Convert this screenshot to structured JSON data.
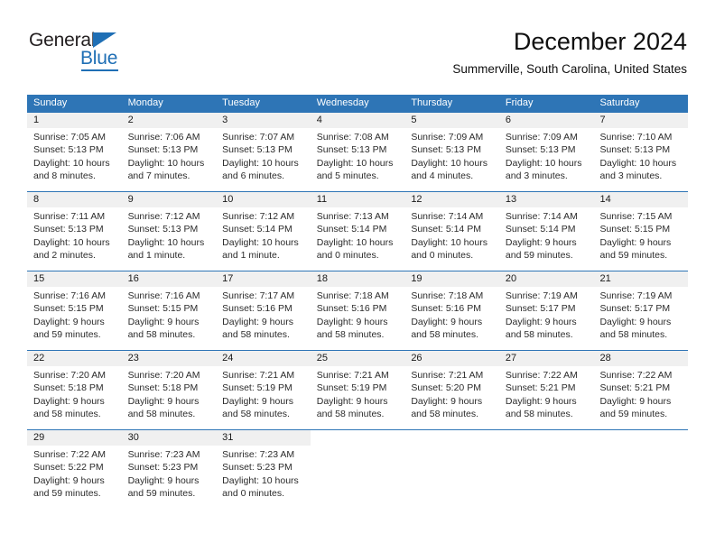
{
  "logo": {
    "top_text": "General",
    "bottom_text": "Blue",
    "accent_color": "#1f6fb5"
  },
  "header": {
    "title": "December 2024",
    "subtitle": "Summerville, South Carolina, United States"
  },
  "theme": {
    "header_blue": "#2e75b6",
    "day_band_gray": "#f0f0f0"
  },
  "weekdays": [
    "Sunday",
    "Monday",
    "Tuesday",
    "Wednesday",
    "Thursday",
    "Friday",
    "Saturday"
  ],
  "weeks": [
    [
      {
        "day": "1",
        "sunrise": "Sunrise: 7:05 AM",
        "sunset": "Sunset: 5:13 PM",
        "daylight_line1": "Daylight: 10 hours",
        "daylight_line2": "and 8 minutes."
      },
      {
        "day": "2",
        "sunrise": "Sunrise: 7:06 AM",
        "sunset": "Sunset: 5:13 PM",
        "daylight_line1": "Daylight: 10 hours",
        "daylight_line2": "and 7 minutes."
      },
      {
        "day": "3",
        "sunrise": "Sunrise: 7:07 AM",
        "sunset": "Sunset: 5:13 PM",
        "daylight_line1": "Daylight: 10 hours",
        "daylight_line2": "and 6 minutes."
      },
      {
        "day": "4",
        "sunrise": "Sunrise: 7:08 AM",
        "sunset": "Sunset: 5:13 PM",
        "daylight_line1": "Daylight: 10 hours",
        "daylight_line2": "and 5 minutes."
      },
      {
        "day": "5",
        "sunrise": "Sunrise: 7:09 AM",
        "sunset": "Sunset: 5:13 PM",
        "daylight_line1": "Daylight: 10 hours",
        "daylight_line2": "and 4 minutes."
      },
      {
        "day": "6",
        "sunrise": "Sunrise: 7:09 AM",
        "sunset": "Sunset: 5:13 PM",
        "daylight_line1": "Daylight: 10 hours",
        "daylight_line2": "and 3 minutes."
      },
      {
        "day": "7",
        "sunrise": "Sunrise: 7:10 AM",
        "sunset": "Sunset: 5:13 PM",
        "daylight_line1": "Daylight: 10 hours",
        "daylight_line2": "and 3 minutes."
      }
    ],
    [
      {
        "day": "8",
        "sunrise": "Sunrise: 7:11 AM",
        "sunset": "Sunset: 5:13 PM",
        "daylight_line1": "Daylight: 10 hours",
        "daylight_line2": "and 2 minutes."
      },
      {
        "day": "9",
        "sunrise": "Sunrise: 7:12 AM",
        "sunset": "Sunset: 5:13 PM",
        "daylight_line1": "Daylight: 10 hours",
        "daylight_line2": "and 1 minute."
      },
      {
        "day": "10",
        "sunrise": "Sunrise: 7:12 AM",
        "sunset": "Sunset: 5:14 PM",
        "daylight_line1": "Daylight: 10 hours",
        "daylight_line2": "and 1 minute."
      },
      {
        "day": "11",
        "sunrise": "Sunrise: 7:13 AM",
        "sunset": "Sunset: 5:14 PM",
        "daylight_line1": "Daylight: 10 hours",
        "daylight_line2": "and 0 minutes."
      },
      {
        "day": "12",
        "sunrise": "Sunrise: 7:14 AM",
        "sunset": "Sunset: 5:14 PM",
        "daylight_line1": "Daylight: 10 hours",
        "daylight_line2": "and 0 minutes."
      },
      {
        "day": "13",
        "sunrise": "Sunrise: 7:14 AM",
        "sunset": "Sunset: 5:14 PM",
        "daylight_line1": "Daylight: 9 hours",
        "daylight_line2": "and 59 minutes."
      },
      {
        "day": "14",
        "sunrise": "Sunrise: 7:15 AM",
        "sunset": "Sunset: 5:15 PM",
        "daylight_line1": "Daylight: 9 hours",
        "daylight_line2": "and 59 minutes."
      }
    ],
    [
      {
        "day": "15",
        "sunrise": "Sunrise: 7:16 AM",
        "sunset": "Sunset: 5:15 PM",
        "daylight_line1": "Daylight: 9 hours",
        "daylight_line2": "and 59 minutes."
      },
      {
        "day": "16",
        "sunrise": "Sunrise: 7:16 AM",
        "sunset": "Sunset: 5:15 PM",
        "daylight_line1": "Daylight: 9 hours",
        "daylight_line2": "and 58 minutes."
      },
      {
        "day": "17",
        "sunrise": "Sunrise: 7:17 AM",
        "sunset": "Sunset: 5:16 PM",
        "daylight_line1": "Daylight: 9 hours",
        "daylight_line2": "and 58 minutes."
      },
      {
        "day": "18",
        "sunrise": "Sunrise: 7:18 AM",
        "sunset": "Sunset: 5:16 PM",
        "daylight_line1": "Daylight: 9 hours",
        "daylight_line2": "and 58 minutes."
      },
      {
        "day": "19",
        "sunrise": "Sunrise: 7:18 AM",
        "sunset": "Sunset: 5:16 PM",
        "daylight_line1": "Daylight: 9 hours",
        "daylight_line2": "and 58 minutes."
      },
      {
        "day": "20",
        "sunrise": "Sunrise: 7:19 AM",
        "sunset": "Sunset: 5:17 PM",
        "daylight_line1": "Daylight: 9 hours",
        "daylight_line2": "and 58 minutes."
      },
      {
        "day": "21",
        "sunrise": "Sunrise: 7:19 AM",
        "sunset": "Sunset: 5:17 PM",
        "daylight_line1": "Daylight: 9 hours",
        "daylight_line2": "and 58 minutes."
      }
    ],
    [
      {
        "day": "22",
        "sunrise": "Sunrise: 7:20 AM",
        "sunset": "Sunset: 5:18 PM",
        "daylight_line1": "Daylight: 9 hours",
        "daylight_line2": "and 58 minutes."
      },
      {
        "day": "23",
        "sunrise": "Sunrise: 7:20 AM",
        "sunset": "Sunset: 5:18 PM",
        "daylight_line1": "Daylight: 9 hours",
        "daylight_line2": "and 58 minutes."
      },
      {
        "day": "24",
        "sunrise": "Sunrise: 7:21 AM",
        "sunset": "Sunset: 5:19 PM",
        "daylight_line1": "Daylight: 9 hours",
        "daylight_line2": "and 58 minutes."
      },
      {
        "day": "25",
        "sunrise": "Sunrise: 7:21 AM",
        "sunset": "Sunset: 5:19 PM",
        "daylight_line1": "Daylight: 9 hours",
        "daylight_line2": "and 58 minutes."
      },
      {
        "day": "26",
        "sunrise": "Sunrise: 7:21 AM",
        "sunset": "Sunset: 5:20 PM",
        "daylight_line1": "Daylight: 9 hours",
        "daylight_line2": "and 58 minutes."
      },
      {
        "day": "27",
        "sunrise": "Sunrise: 7:22 AM",
        "sunset": "Sunset: 5:21 PM",
        "daylight_line1": "Daylight: 9 hours",
        "daylight_line2": "and 58 minutes."
      },
      {
        "day": "28",
        "sunrise": "Sunrise: 7:22 AM",
        "sunset": "Sunset: 5:21 PM",
        "daylight_line1": "Daylight: 9 hours",
        "daylight_line2": "and 59 minutes."
      }
    ],
    [
      {
        "day": "29",
        "sunrise": "Sunrise: 7:22 AM",
        "sunset": "Sunset: 5:22 PM",
        "daylight_line1": "Daylight: 9 hours",
        "daylight_line2": "and 59 minutes."
      },
      {
        "day": "30",
        "sunrise": "Sunrise: 7:23 AM",
        "sunset": "Sunset: 5:23 PM",
        "daylight_line1": "Daylight: 9 hours",
        "daylight_line2": "and 59 minutes."
      },
      {
        "day": "31",
        "sunrise": "Sunrise: 7:23 AM",
        "sunset": "Sunset: 5:23 PM",
        "daylight_line1": "Daylight: 10 hours",
        "daylight_line2": "and 0 minutes."
      },
      {
        "day": "",
        "sunrise": "",
        "sunset": "",
        "daylight_line1": "",
        "daylight_line2": ""
      },
      {
        "day": "",
        "sunrise": "",
        "sunset": "",
        "daylight_line1": "",
        "daylight_line2": ""
      },
      {
        "day": "",
        "sunrise": "",
        "sunset": "",
        "daylight_line1": "",
        "daylight_line2": ""
      },
      {
        "day": "",
        "sunrise": "",
        "sunset": "",
        "daylight_line1": "",
        "daylight_line2": ""
      }
    ]
  ]
}
